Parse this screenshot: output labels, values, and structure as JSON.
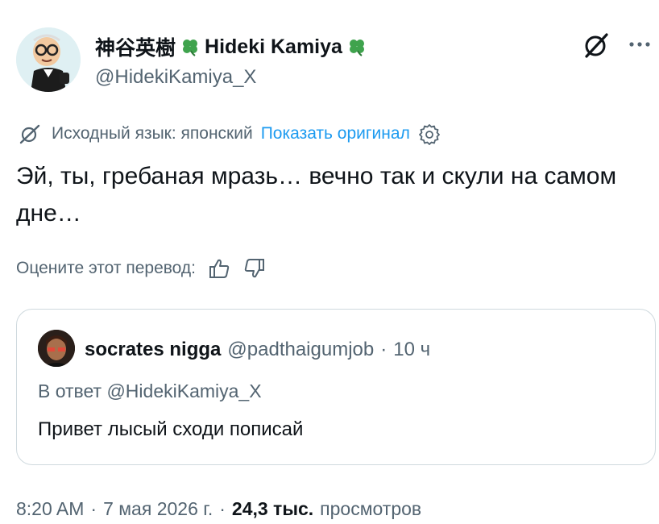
{
  "author": {
    "display_name_jp": "神谷英樹",
    "display_name_en": "Hideki Kamiya",
    "handle": "@HidekiKamiya_X"
  },
  "icons": {
    "grok": "grok-slash-icon",
    "more": "more-dots-icon",
    "translate": "translate-icon",
    "settings": "gear-icon",
    "like": "thumbs-up-icon",
    "dislike": "thumbs-down-icon",
    "clover": "four-leaf-clover-icon"
  },
  "translation": {
    "source_label": "Исходный язык: японский",
    "show_original": "Показать оригинал"
  },
  "tweet_text": "Эй, ты, гребаная мразь… вечно так и скули на самом дне…",
  "rating": {
    "label": "Оцените этот перевод:"
  },
  "quote": {
    "name": "socrates nigga",
    "handle": "@padthaigumjob",
    "separator": "·",
    "time": "10 ч",
    "reply_to": "В ответ @HidekiKamiya_X",
    "text": "Привет лысый сходи пописай"
  },
  "meta": {
    "time": "8:20 AM",
    "sep1": "·",
    "date": "7 мая 2026 г.",
    "sep2": "·",
    "views_count": "24,3 тыс.",
    "views_label": "просмотров"
  },
  "colors": {
    "text": "#0f1419",
    "secondary": "#536471",
    "link": "#1d9bf0",
    "border": "#cfd9de",
    "clover": "#3fa34d"
  }
}
